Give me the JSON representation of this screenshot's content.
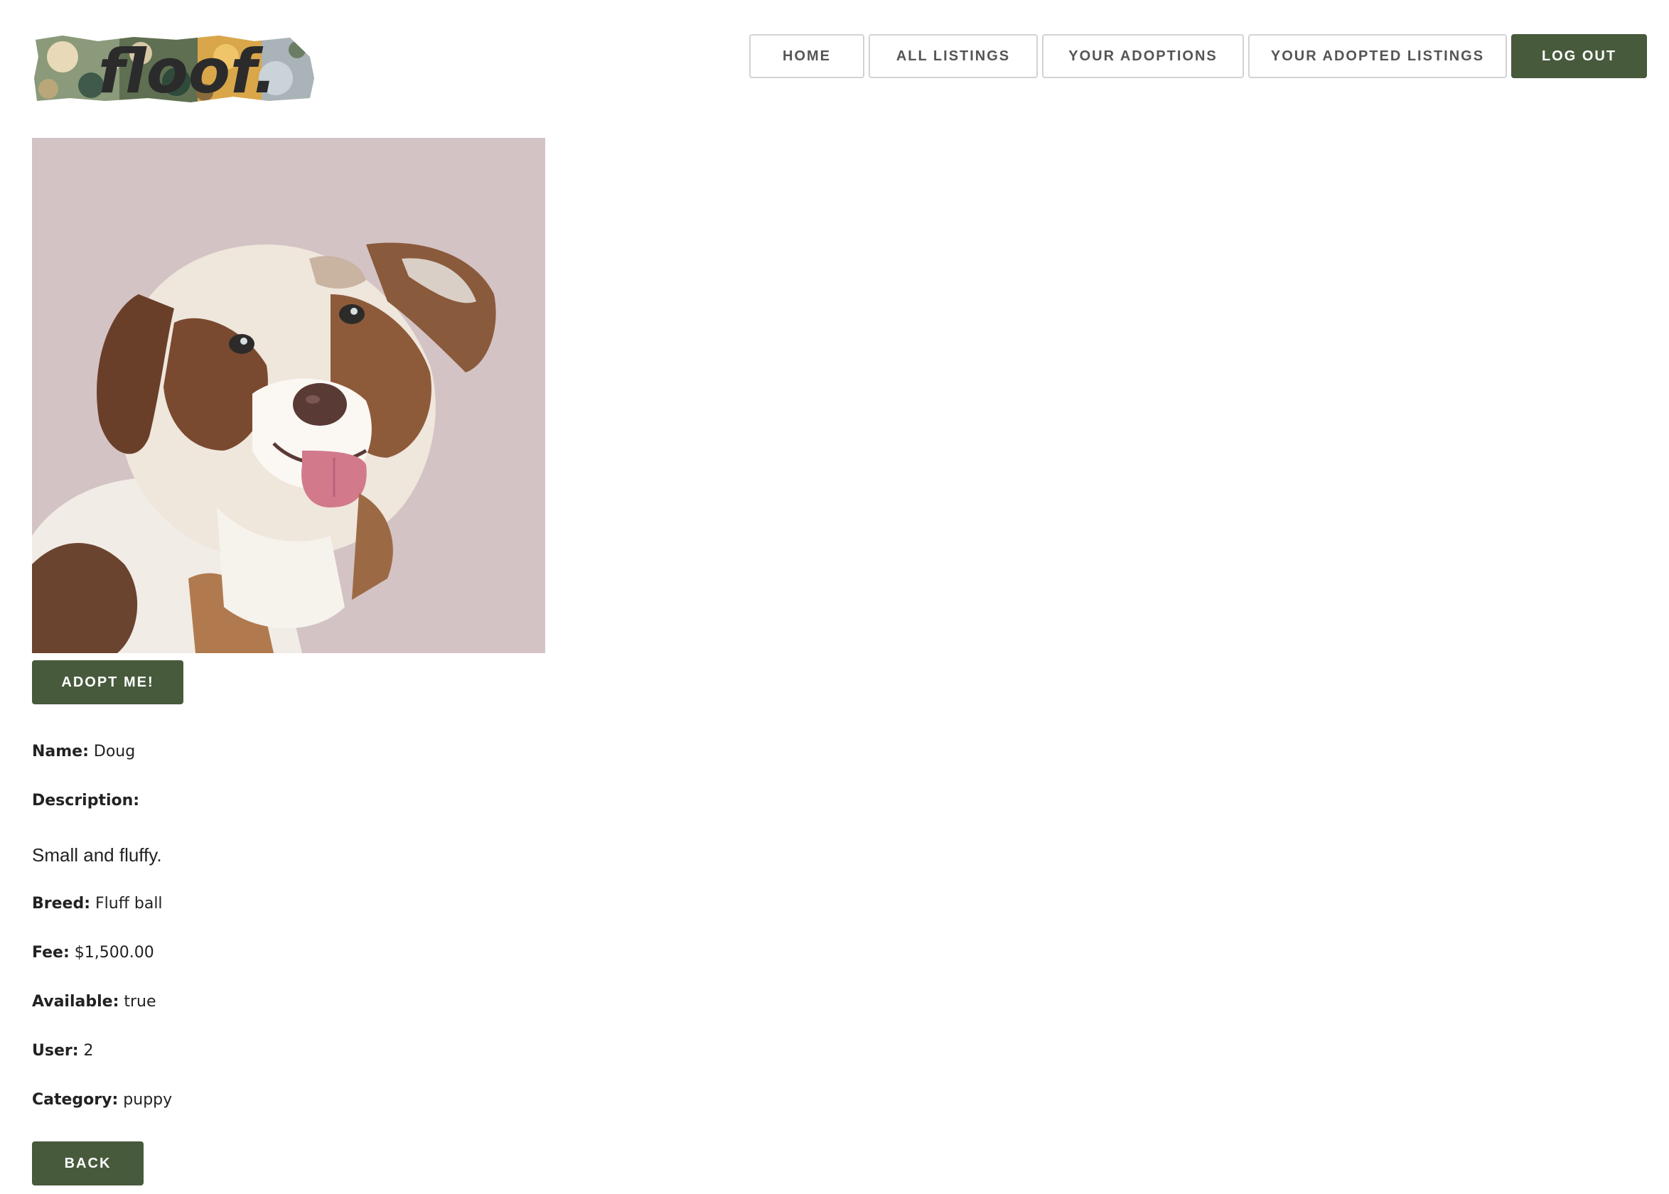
{
  "app": {
    "logo_text": "floof."
  },
  "nav": {
    "home": "HOME",
    "all_listings": "ALL LISTINGS",
    "your_adoptions": "YOUR ADOPTIONS",
    "your_adopted_listings": "YOUR ADOPTED LISTINGS",
    "log_out": "LOG OUT"
  },
  "listing": {
    "photo_icon": "dog-photo-icon",
    "adopt_label": "ADOPT ME!",
    "fields": {
      "name_label": "Name:",
      "name_value": "Doug",
      "description_label": "Description:",
      "description_value": "Small and fluffy.",
      "breed_label": "Breed:",
      "breed_value": "Fluff ball",
      "fee_label": "Fee:",
      "fee_value": "$1,500.00",
      "available_label": "Available:",
      "available_value": "true",
      "user_label": "User:",
      "user_value": "2",
      "category_label": "Category:",
      "category_value": "puppy"
    },
    "back_label": "BACK"
  },
  "colors": {
    "primary_green": "#475a3c",
    "photo_background": "#d4c3c4",
    "nav_border": "#d3d3d3"
  }
}
